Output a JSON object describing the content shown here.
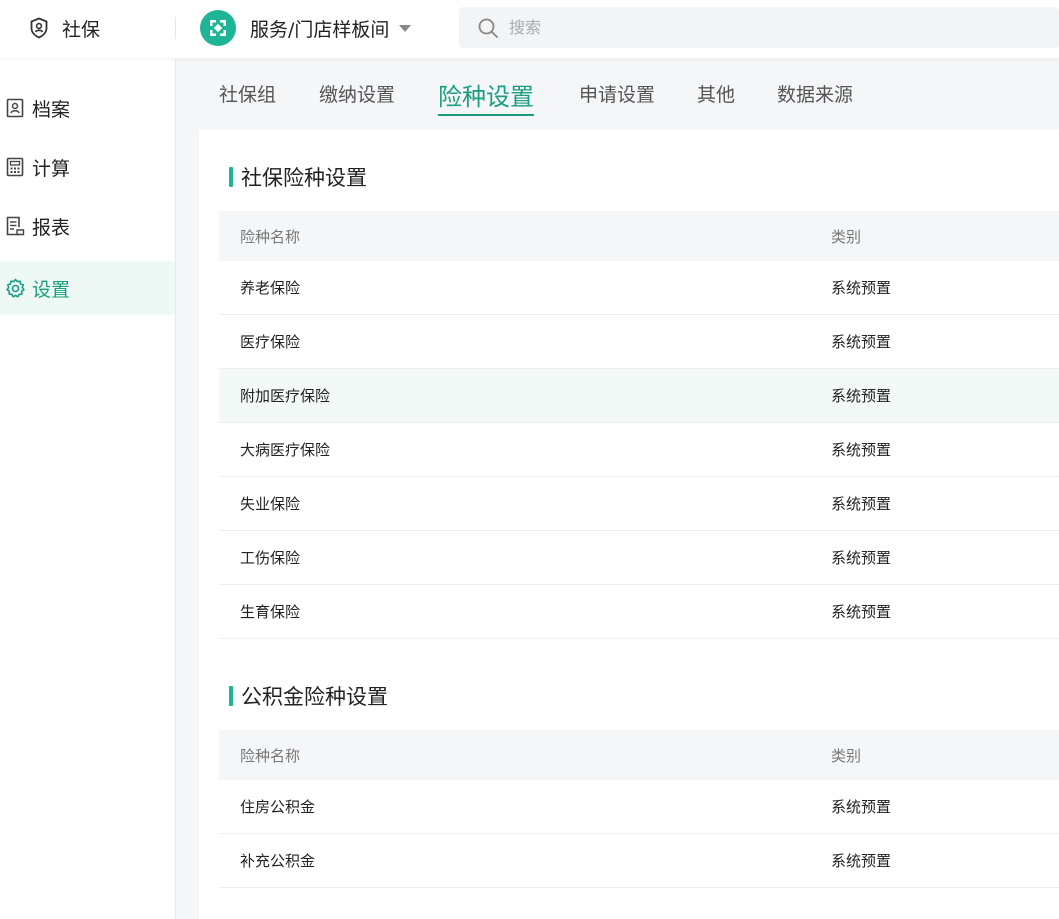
{
  "app": {
    "name": "社保"
  },
  "store": {
    "name": "服务/门店样板间"
  },
  "search": {
    "placeholder": "搜索"
  },
  "sidebar": {
    "items": [
      {
        "label": "档案",
        "icon": "archive-icon"
      },
      {
        "label": "计算",
        "icon": "calculator-icon"
      },
      {
        "label": "报表",
        "icon": "report-icon"
      },
      {
        "label": "设置",
        "icon": "gear-icon",
        "active": true
      }
    ]
  },
  "tabs": [
    {
      "label": "社保组"
    },
    {
      "label": "缴纳设置"
    },
    {
      "label": "险种设置",
      "active": true
    },
    {
      "label": "申请设置"
    },
    {
      "label": "其他"
    },
    {
      "label": "数据来源"
    }
  ],
  "social_insurance": {
    "title": "社保险种设置",
    "columns": [
      "险种名称",
      "类别"
    ],
    "rows": [
      {
        "name": "养老保险",
        "type": "系统预置"
      },
      {
        "name": "医疗保险",
        "type": "系统预置"
      },
      {
        "name": "附加医疗保险",
        "type": "系统预置"
      },
      {
        "name": "大病医疗保险",
        "type": "系统预置"
      },
      {
        "name": "失业保险",
        "type": "系统预置"
      },
      {
        "name": "工伤保险",
        "type": "系统预置"
      },
      {
        "name": "生育保险",
        "type": "系统预置"
      }
    ]
  },
  "housing_fund": {
    "title": "公积金险种设置",
    "columns": [
      "险种名称",
      "类别"
    ],
    "rows": [
      {
        "name": "住房公积金",
        "type": "系统预置"
      },
      {
        "name": "补充公积金",
        "type": "系统预置"
      }
    ]
  },
  "colors": {
    "accent": "#1a9e80",
    "brand": "#1eb595"
  }
}
